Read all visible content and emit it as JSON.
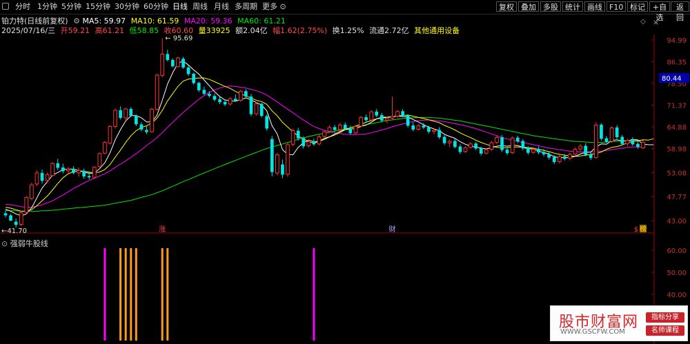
{
  "toolbar": {
    "periods": [
      "分时",
      "1分钟",
      "5分钟",
      "15分钟",
      "30分钟",
      "60分钟",
      "日线",
      "周线",
      "月线",
      "多周期",
      "更多"
    ],
    "active": "日线",
    "right": [
      "复权",
      "叠加",
      "多股",
      "统计",
      "画线",
      "F10",
      "标记",
      "+自选",
      "返回"
    ]
  },
  "header": {
    "stock": "铂力特(日线前复权)",
    "ma5": "MA5: 59.97",
    "ma10": "MA10: 61.59",
    "ma20": "MA20: 59.36",
    "ma60": "MA60: 61.21",
    "date": "2025/07/16/三",
    "open": "开59.21",
    "high": "高61.21",
    "low": "低58.85",
    "close": "收60.60",
    "volume": "量33925",
    "amount": "额2.04亿",
    "change": "幅1.62(2.75%)",
    "turnover": "换1.25%",
    "float": "流通2.72亿",
    "sector": "其他通用设备"
  },
  "colors": {
    "up": "#ff3232",
    "down": "#00e4e4",
    "ma5": "#ffffff",
    "ma10": "#ffff00",
    "ma20": "#ff00ff",
    "ma60": "#00e600",
    "signal_magenta": "#ff00ff",
    "signal_orange": "#ff9b1a",
    "axis": "#a00000",
    "price_badge": "#0000a8"
  },
  "chart_data": [
    {
      "type": "candlestick",
      "title": "铂力特(日线前复权)",
      "y_ticks": [
        "94.99",
        "86.35",
        "78.50",
        "71.37",
        "64.88",
        "58.98",
        "53.08",
        "47.77",
        "43.00"
      ],
      "ylim": [
        41.0,
        97.5
      ],
      "current_price_label": "80.44",
      "max_label": "95.69",
      "min_label": "41.70",
      "event_markers": [
        "涨",
        "财",
        "榜",
        "$"
      ],
      "candles": [
        [
          44.4,
          45.0,
          43.6,
          44.0
        ],
        [
          44.0,
          44.3,
          42.9,
          43.0
        ],
        [
          42.8,
          43.4,
          41.7,
          42.2
        ],
        [
          42.3,
          44.8,
          42.0,
          44.5
        ],
        [
          44.6,
          47.9,
          44.3,
          47.6
        ],
        [
          47.4,
          50.8,
          47.0,
          50.3
        ],
        [
          50.5,
          53.6,
          50.0,
          53.0
        ],
        [
          53.0,
          53.8,
          50.6,
          51.2
        ],
        [
          51.3,
          53.1,
          50.7,
          52.6
        ],
        [
          52.4,
          55.6,
          52.2,
          55.2
        ],
        [
          55.3,
          56.4,
          53.7,
          54.2
        ],
        [
          54.3,
          55.2,
          52.9,
          53.4
        ],
        [
          53.5,
          54.4,
          52.6,
          53.9
        ],
        [
          54.0,
          54.6,
          52.7,
          53.0
        ],
        [
          53.0,
          54.3,
          52.1,
          53.6
        ],
        [
          53.5,
          54.0,
          51.7,
          52.2
        ],
        [
          52.3,
          53.2,
          51.5,
          52.0
        ],
        [
          52.0,
          54.6,
          51.6,
          54.4
        ],
        [
          54.5,
          58.0,
          54.3,
          57.7
        ],
        [
          57.8,
          61.0,
          57.5,
          60.6
        ],
        [
          60.4,
          65.3,
          60.0,
          65.0
        ],
        [
          65.0,
          70.3,
          64.4,
          69.8
        ],
        [
          69.8,
          71.0,
          67.0,
          67.5
        ],
        [
          67.5,
          70.6,
          66.8,
          70.2
        ],
        [
          70.2,
          70.8,
          67.8,
          68.1
        ],
        [
          68.2,
          68.5,
          65.1,
          65.6
        ],
        [
          65.6,
          66.2,
          63.6,
          64.1
        ],
        [
          64.0,
          65.3,
          62.8,
          63.4
        ],
        [
          63.5,
          70.6,
          63.2,
          70.1
        ],
        [
          70.1,
          82.0,
          69.6,
          81.4
        ],
        [
          81.3,
          95.7,
          80.6,
          89.3
        ],
        [
          89.3,
          91.0,
          86.4,
          87.0
        ],
        [
          87.0,
          87.6,
          84.2,
          84.6
        ],
        [
          84.5,
          88.3,
          84.2,
          87.8
        ],
        [
          87.5,
          88.2,
          83.7,
          84.2
        ],
        [
          84.2,
          84.9,
          81.1,
          81.8
        ],
        [
          81.9,
          82.3,
          78.1,
          78.6
        ],
        [
          78.7,
          79.1,
          75.6,
          76.2
        ],
        [
          76.3,
          77.4,
          74.6,
          75.0
        ],
        [
          75.0,
          75.9,
          73.8,
          74.3
        ],
        [
          74.3,
          75.1,
          72.6,
          73.1
        ],
        [
          73.2,
          74.0,
          71.7,
          72.3
        ],
        [
          72.4,
          73.2,
          71.0,
          71.6
        ],
        [
          71.7,
          73.9,
          71.2,
          73.4
        ],
        [
          73.4,
          74.8,
          72.4,
          72.8
        ],
        [
          72.9,
          76.3,
          72.5,
          75.9
        ],
        [
          75.9,
          76.6,
          73.7,
          74.1
        ],
        [
          74.1,
          75.0,
          68.0,
          68.6
        ],
        [
          68.7,
          72.3,
          68.2,
          71.8
        ],
        [
          71.8,
          72.1,
          67.6,
          68.1
        ],
        [
          68.0,
          68.6,
          63.8,
          64.4
        ],
        [
          61.5,
          62.3,
          52.2,
          53.2
        ],
        [
          53.0,
          57.9,
          52.5,
          57.4
        ],
        [
          55.0,
          56.2,
          51.8,
          52.6
        ],
        [
          52.7,
          60.6,
          52.1,
          60.0
        ],
        [
          60.1,
          64.4,
          59.6,
          63.8
        ],
        [
          63.8,
          64.6,
          61.1,
          61.7
        ],
        [
          61.8,
          62.2,
          59.0,
          59.6
        ],
        [
          59.7,
          61.4,
          59.2,
          60.8
        ],
        [
          60.9,
          61.6,
          59.7,
          60.1
        ],
        [
          60.2,
          62.7,
          59.8,
          62.1
        ],
        [
          62.2,
          64.0,
          61.9,
          63.5
        ],
        [
          63.6,
          65.3,
          63.1,
          64.7
        ],
        [
          64.8,
          65.4,
          63.4,
          64.0
        ],
        [
          64.1,
          66.0,
          63.7,
          65.4
        ],
        [
          65.5,
          66.2,
          63.9,
          64.3
        ],
        [
          64.4,
          65.3,
          62.6,
          63.1
        ],
        [
          63.2,
          65.5,
          62.9,
          65.0
        ],
        [
          65.1,
          68.1,
          64.7,
          67.6
        ],
        [
          67.7,
          68.5,
          66.3,
          66.8
        ],
        [
          66.9,
          69.8,
          66.5,
          69.3
        ],
        [
          69.4,
          70.2,
          67.7,
          68.2
        ],
        [
          68.3,
          69.0,
          66.2,
          66.7
        ],
        [
          66.8,
          67.8,
          65.9,
          67.3
        ],
        [
          67.4,
          74.1,
          66.9,
          67.9
        ],
        [
          68.0,
          69.9,
          67.5,
          69.4
        ],
        [
          69.5,
          70.1,
          67.7,
          68.1
        ],
        [
          68.2,
          68.6,
          64.7,
          65.2
        ],
        [
          65.3,
          66.2,
          63.6,
          64.1
        ],
        [
          64.2,
          65.7,
          63.9,
          65.2
        ],
        [
          65.3,
          66.0,
          64.2,
          64.7
        ],
        [
          64.8,
          65.2,
          63.0,
          63.5
        ],
        [
          63.6,
          64.4,
          62.8,
          63.9
        ],
        [
          64.0,
          64.8,
          61.5,
          62.0
        ],
        [
          62.1,
          62.6,
          59.9,
          60.4
        ],
        [
          60.5,
          61.4,
          59.3,
          60.9
        ],
        [
          61.0,
          61.5,
          59.0,
          59.4
        ],
        [
          59.5,
          60.1,
          57.6,
          58.1
        ],
        [
          58.2,
          59.6,
          57.9,
          59.2
        ],
        [
          59.3,
          60.7,
          59.0,
          60.2
        ],
        [
          60.3,
          60.8,
          58.6,
          59.0
        ],
        [
          59.1,
          59.5,
          57.2,
          57.7
        ],
        [
          57.8,
          59.0,
          57.5,
          58.7
        ],
        [
          58.8,
          61.0,
          58.4,
          60.5
        ],
        [
          60.6,
          62.5,
          60.1,
          61.9
        ],
        [
          62.0,
          62.6,
          58.1,
          58.6
        ],
        [
          58.7,
          59.3,
          57.3,
          57.8
        ],
        [
          57.9,
          62.2,
          57.6,
          61.8
        ],
        [
          61.9,
          62.4,
          60.4,
          60.9
        ],
        [
          61.0,
          61.5,
          58.5,
          59.0
        ],
        [
          59.1,
          59.6,
          57.4,
          57.9
        ],
        [
          58.0,
          59.3,
          57.6,
          58.8
        ],
        [
          58.9,
          59.5,
          57.5,
          58.0
        ],
        [
          58.1,
          58.9,
          57.0,
          57.5
        ],
        [
          57.6,
          58.3,
          56.2,
          56.7
        ],
        [
          56.8,
          57.3,
          55.1,
          55.6
        ],
        [
          55.7,
          57.4,
          55.2,
          56.9
        ],
        [
          57.0,
          57.6,
          56.0,
          56.4
        ],
        [
          56.5,
          58.0,
          56.0,
          57.5
        ],
        [
          57.6,
          59.3,
          57.1,
          58.8
        ],
        [
          58.9,
          60.2,
          58.3,
          59.6
        ],
        [
          59.7,
          60.4,
          57.0,
          57.4
        ],
        [
          57.5,
          58.2,
          56.1,
          56.6
        ],
        [
          56.7,
          66.2,
          56.4,
          65.4
        ],
        [
          65.5,
          65.9,
          61.1,
          61.6
        ],
        [
          61.7,
          62.3,
          60.4,
          60.8
        ],
        [
          60.9,
          65.0,
          60.5,
          64.6
        ],
        [
          64.7,
          65.4,
          61.5,
          62.0
        ],
        [
          62.1,
          62.6,
          59.8,
          60.2
        ],
        [
          60.3,
          61.6,
          59.7,
          61.1
        ],
        [
          61.2,
          62.0,
          59.7,
          60.1
        ],
        [
          60.2,
          60.9,
          58.9,
          59.4
        ],
        [
          59.21,
          61.21,
          58.85,
          60.6
        ]
      ],
      "ma5": [
        45.2,
        44.8,
        44.3,
        43.9,
        44.3,
        45.5,
        47.5,
        49.6,
        51.0,
        52.5,
        53.1,
        53.8,
        53.9,
        53.9,
        53.6,
        53.2,
        52.9,
        53.0,
        54.0,
        55.4,
        57.9,
        61.3,
        64.1,
        66.6,
        68.1,
        68.2,
        67.5,
        66.3,
        66.3,
        68.3,
        72.9,
        78.3,
        82.3,
        85.8,
        86.6,
        85.1,
        83.3,
        81.8,
        79.7,
        77.7,
        75.7,
        74.1,
        73.0,
        72.7,
        72.6,
        73.1,
        73.7,
        73.0,
        72.2,
        71.4,
        69.6,
        65.2,
        62.9,
        58.7,
        57.5,
        57.4,
        59.3,
        60.5,
        61.2,
        60.8,
        60.9,
        61.4,
        62.1,
        62.6,
        63.3,
        64.1,
        64.3,
        64.4,
        65.0,
        65.4,
        66.2,
        67.2,
        67.7,
        67.7,
        67.9,
        68.0,
        67.9,
        67.8,
        67.0,
        66.3,
        65.5,
        64.8,
        64.3,
        63.8,
        62.8,
        62.2,
        61.7,
        60.8,
        60.1,
        59.6,
        59.4,
        59.1,
        58.9,
        59.2,
        59.6,
        59.8,
        59.6,
        59.8,
        59.8,
        59.3,
        58.9,
        58.9,
        58.3,
        58.0,
        57.6,
        56.9,
        56.7,
        56.7,
        56.7,
        57.0,
        57.6,
        58.0,
        58.1,
        59.4,
        60.2,
        60.1,
        61.1,
        61.3,
        61.0,
        61.0,
        61.4,
        61.3,
        60.1,
        60.0,
        59.97
      ],
      "ma10": [
        45.6,
        45.4,
        45.1,
        44.8,
        44.8,
        45.1,
        45.9,
        46.9,
        47.9,
        49.2,
        50.6,
        51.9,
        52.8,
        53.3,
        53.5,
        53.4,
        53.2,
        53.0,
        53.2,
        53.8,
        55.0,
        56.8,
        58.6,
        60.6,
        62.4,
        63.8,
        64.7,
        65.2,
        66.0,
        67.4,
        69.7,
        72.7,
        75.1,
        77.5,
        79.3,
        80.0,
        80.2,
        80.4,
        80.4,
        79.9,
        79.1,
        78.3,
        77.5,
        76.8,
        75.8,
        75.0,
        74.3,
        73.6,
        72.9,
        72.5,
        71.6,
        69.6,
        68.1,
        66.2,
        64.8,
        63.5,
        62.3,
        61.6,
        60.8,
        60.4,
        60.9,
        61.7,
        62.1,
        62.9,
        63.6,
        64.2,
        64.6,
        65.1,
        65.6,
        66.2,
        66.7,
        67.2,
        67.4,
        67.6,
        67.8,
        68.1,
        68.2,
        68.3,
        68.0,
        67.6,
        67.3,
        66.9,
        66.5,
        66.1,
        65.3,
        64.7,
        64.0,
        63.2,
        62.5,
        61.9,
        61.2,
        60.6,
        60.1,
        59.7,
        59.3,
        59.2,
        59.2,
        59.4,
        59.4,
        59.4,
        59.2,
        59.1,
        58.8,
        58.5,
        58.2,
        57.8,
        57.5,
        57.3,
        57.1,
        57.0,
        57.1,
        57.3,
        57.5,
        57.7,
        58.1,
        58.8,
        59.3,
        59.5,
        59.9,
        60.5,
        60.9,
        61.0,
        61.3,
        61.2,
        61.59
      ],
      "ma20": [
        46.2,
        46.1,
        45.9,
        45.7,
        45.6,
        45.6,
        45.8,
        46.1,
        46.5,
        46.9,
        47.5,
        48.1,
        48.8,
        49.5,
        50.1,
        50.7,
        51.3,
        51.8,
        52.3,
        52.8,
        53.5,
        54.3,
        55.1,
        55.9,
        56.8,
        57.7,
        58.7,
        59.8,
        60.8,
        61.9,
        63.3,
        64.7,
        66.2,
        67.6,
        69.1,
        70.5,
        71.9,
        73.2,
        74.4,
        75.5,
        76.3,
        76.9,
        77.4,
        77.6,
        77.5,
        77.2,
        76.9,
        76.5,
        76.0,
        75.4,
        74.6,
        73.5,
        72.4,
        71.2,
        70.1,
        69.0,
        67.9,
        66.9,
        65.9,
        65.0,
        64.4,
        63.9,
        63.5,
        63.2,
        63.0,
        62.8,
        62.7,
        62.7,
        62.8,
        62.9,
        63.2,
        63.6,
        64.0,
        64.4,
        64.9,
        65.3,
        65.7,
        66.1,
        66.4,
        66.7,
        66.8,
        66.9,
        66.8,
        66.6,
        66.4,
        66.1,
        65.8,
        65.5,
        65.2,
        64.8,
        64.4,
        63.9,
        63.4,
        62.9,
        62.4,
        61.9,
        61.5,
        61.2,
        60.9,
        60.6,
        60.3,
        60.0,
        59.7,
        59.4,
        59.1,
        58.9,
        58.7,
        58.5,
        58.3,
        58.2,
        58.1,
        58.1,
        58.1,
        58.2,
        58.3,
        58.5,
        58.7,
        58.9,
        59.1,
        59.3,
        59.4,
        59.4,
        59.36
      ],
      "ma60": [
        45.0,
        44.9,
        44.9,
        44.8,
        44.8,
        44.8,
        44.8,
        44.9,
        44.9,
        45.0,
        45.1,
        45.2,
        45.3,
        45.4,
        45.5,
        45.6,
        45.7,
        45.8,
        45.9,
        46.0,
        46.2,
        46.4,
        46.6,
        46.8,
        47.0,
        47.3,
        47.6,
        47.9,
        48.2,
        48.6,
        49.0,
        49.5,
        50.0,
        50.5,
        51.0,
        51.5,
        52.0,
        52.5,
        53.0,
        53.5,
        54.0,
        54.5,
        55.0,
        55.5,
        56.0,
        56.5,
        57.0,
        57.5,
        58.0,
        58.5,
        59.0,
        59.4,
        59.8,
        60.2,
        60.6,
        61.0,
        61.4,
        61.8,
        62.2,
        62.5,
        62.8,
        63.1,
        63.4,
        63.7,
        64.0,
        64.3,
        64.6,
        64.9,
        65.2,
        65.5,
        65.8,
        66.1,
        66.4,
        66.7,
        66.9,
        67.1,
        67.3,
        67.4,
        67.5,
        67.6,
        67.6,
        67.6,
        67.5,
        67.4,
        67.2,
        67.0,
        66.8,
        66.6,
        66.3,
        66.0,
        65.7,
        65.4,
        65.1,
        64.8,
        64.5,
        64.2,
        63.9,
        63.6,
        63.3,
        63.0,
        62.7,
        62.4,
        62.2,
        62.0,
        61.8,
        61.6,
        61.4,
        61.2,
        61.0,
        60.9,
        60.8,
        60.7,
        60.6,
        60.6,
        60.6,
        60.7,
        60.8,
        60.9,
        61.0,
        61.1,
        61.1,
        61.1,
        61.21
      ]
    },
    {
      "type": "bar",
      "title": "强弱牛股线",
      "y_ticks": [
        "60.00",
        "50.00",
        "40.00"
      ],
      "signals": [
        {
          "bar_index": 19,
          "color": "#ff00ff"
        },
        {
          "bar_index": 22,
          "color": "#ff9b1a"
        },
        {
          "bar_index": 23,
          "color": "#ff9b1a"
        },
        {
          "bar_index": 24,
          "color": "#ff9b1a"
        },
        {
          "bar_index": 25,
          "color": "#ff9b1a"
        },
        {
          "bar_index": 30,
          "color": "#ff9b1a"
        },
        {
          "bar_index": 31,
          "color": "#ff9b1a"
        },
        {
          "bar_index": 59,
          "color": "#ff00ff"
        }
      ]
    }
  ],
  "watermark": {
    "title": "股市财富网",
    "url": "WWW.GSCFW.COM",
    "btn1": "指标分享",
    "btn2": "名师课程"
  }
}
